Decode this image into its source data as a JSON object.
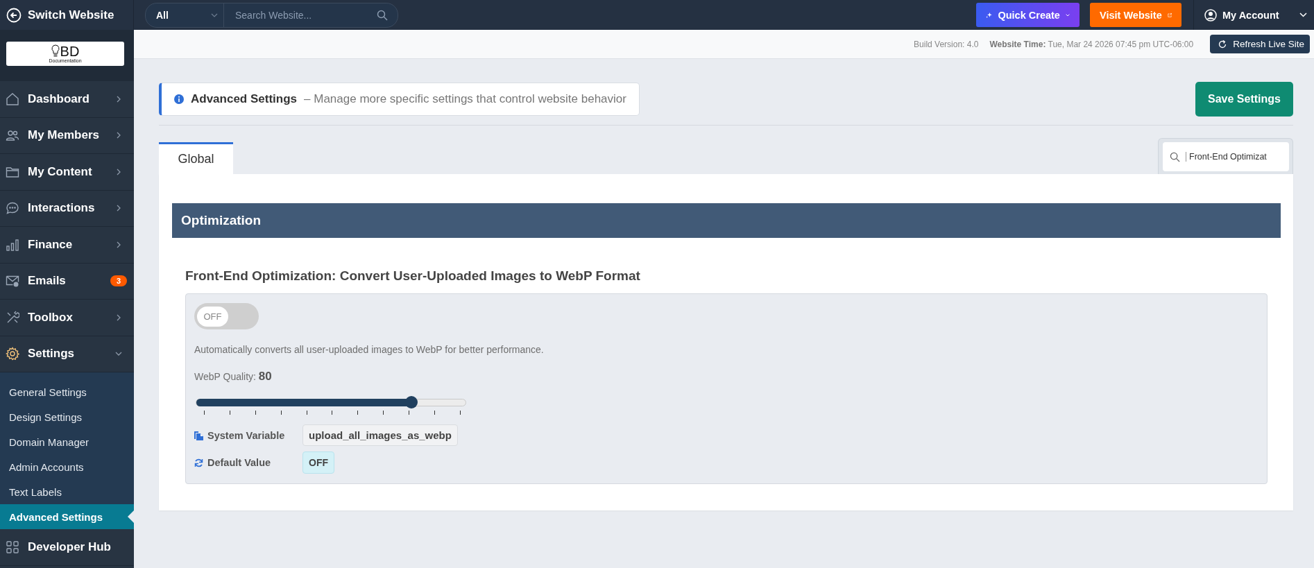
{
  "topbar": {
    "switch_label": "Switch Website",
    "search_scope": "All",
    "search_placeholder": "Search Website...",
    "quick_create": "Quick Create",
    "visit_website": "Visit Website",
    "account": "My Account"
  },
  "subbar": {
    "build_version": "Build Version: 4.0",
    "website_time_label": "Website Time:",
    "website_time": "Tue, Mar 24 2026 07:45 pm UTC-06:00",
    "refresh": "Refresh Live Site"
  },
  "sidebar": {
    "logo_text": "BD",
    "logo_caption": "Documentation",
    "items": [
      {
        "label": "Dashboard",
        "expanded": false
      },
      {
        "label": "My Members",
        "expanded": false
      },
      {
        "label": "My Content",
        "expanded": false
      },
      {
        "label": "Interactions",
        "expanded": false
      },
      {
        "label": "Finance",
        "expanded": false
      },
      {
        "label": "Emails",
        "badge": "3"
      },
      {
        "label": "Toolbox",
        "expanded": false
      },
      {
        "label": "Settings",
        "expanded": true,
        "children": [
          {
            "label": "General Settings",
            "selected": false
          },
          {
            "label": "Design Settings",
            "selected": false
          },
          {
            "label": "Domain Manager",
            "selected": false
          },
          {
            "label": "Admin Accounts",
            "selected": false
          },
          {
            "label": "Text Labels",
            "selected": false
          },
          {
            "label": "Advanced Settings",
            "selected": true
          }
        ]
      },
      {
        "label": "Developer Hub"
      }
    ]
  },
  "header": {
    "title": "Advanced Settings",
    "description": "– Manage more specific settings that control website behavior",
    "save": "Save Settings"
  },
  "tabs": [
    {
      "label": "Global",
      "selected": true
    }
  ],
  "filter": {
    "value": "Front-End Optimizat"
  },
  "section": {
    "title": "Optimization"
  },
  "setting": {
    "title": "Front-End Optimization: Convert User-Uploaded Images to WebP Format",
    "toggle": {
      "on": false,
      "label": "OFF"
    },
    "description": "Automatically converts all user-uploaded images to WebP for better performance.",
    "quality_label": "WebP Quality:",
    "quality_value": "80",
    "slider": {
      "level": 0.8
    },
    "system_variable_label": "System Variable",
    "system_variable": "upload_all_images_as_webp",
    "default_label": "Default Value",
    "default_value": "OFF"
  }
}
